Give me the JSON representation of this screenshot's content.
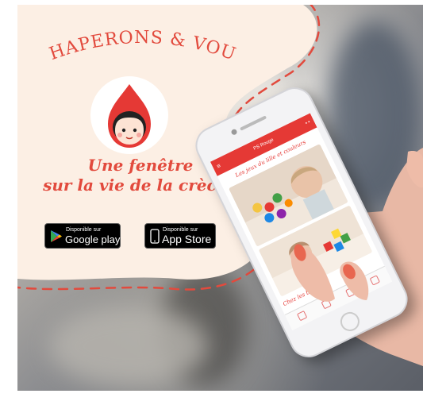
{
  "brand": {
    "name": "CHAPERONS & VOUS",
    "logo_icon": "red-hood-girl-icon",
    "tagline_line1": "Une fenêtre",
    "tagline_line2": "sur la vie de la crèche",
    "accent_color": "#e24a3d",
    "cream_color": "#fcefe4"
  },
  "stores": {
    "google": {
      "small": "Disponible sur",
      "big": "Google play",
      "icon": "google-play-icon"
    },
    "apple": {
      "small": "Disponible sur",
      "big": "App Store",
      "icon": "apple-icon"
    }
  },
  "phone": {
    "appbar_title": "PS Rouge",
    "menu_icon": "hamburger-menu-icon",
    "post_title": "Les jeux du lille et couleurs",
    "second_post_title": "Chez les bous",
    "nav_icons": [
      "home-icon",
      "message-icon",
      "calendar-icon",
      "profile-icon"
    ]
  }
}
